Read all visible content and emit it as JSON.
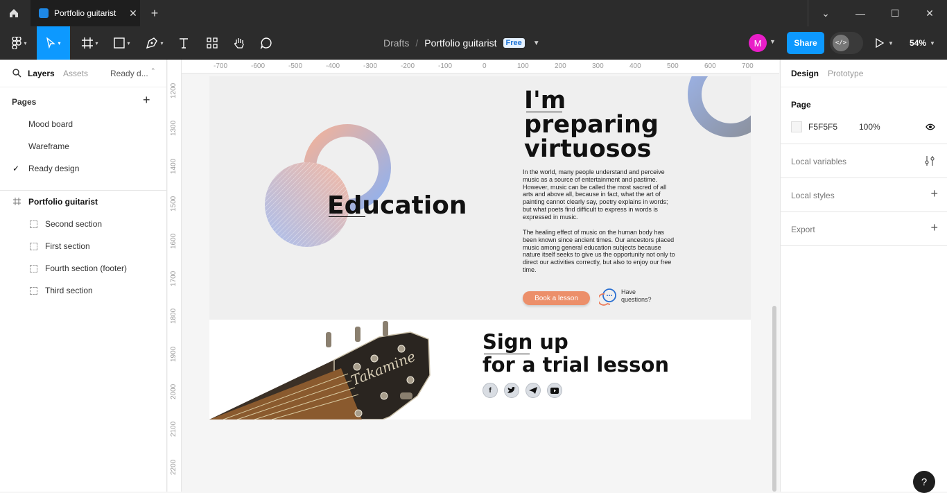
{
  "window": {
    "tab_title": "Portfolio guitarist",
    "tab_close": "✕",
    "new_tab": "+",
    "controls": {
      "chevron": "⌄",
      "minimize": "—",
      "maximize": "☐",
      "close": "✕"
    }
  },
  "toolbar": {
    "breadcrumb": {
      "drafts": "Drafts",
      "slash": "/",
      "file": "Portfolio guitarist",
      "badge": "Free"
    },
    "avatar_letter": "M",
    "share_label": "Share",
    "zoom_label": "54%"
  },
  "left_panel": {
    "tabs": {
      "layers": "Layers",
      "assets": "Assets",
      "page_menu": "Ready d..."
    },
    "pages_heading": "Pages",
    "pages": [
      "Mood board",
      "Wareframe",
      "Ready design"
    ],
    "selected_page_check": "✓",
    "layer_frame": "Portfolio guitarist",
    "layers": [
      "Second section",
      "First section",
      "Fourth section (footer)",
      "Third section"
    ]
  },
  "canvas": {
    "ruler_top": [
      "-700",
      "-600",
      "-500",
      "-400",
      "-300",
      "-200",
      "-100",
      "0",
      "100",
      "200",
      "300",
      "400",
      "500",
      "600",
      "700"
    ],
    "ruler_left": [
      "1200",
      "1300",
      "1400",
      "1500",
      "1600",
      "1700",
      "1800",
      "1900",
      "2000",
      "2100",
      "2200"
    ],
    "design": {
      "education_title": "Education",
      "hero_title_line1": "I'm",
      "hero_title_line2": "preparing",
      "hero_title_line3": "virtuosos",
      "paragraph1": "In the world, many people understand and perceive music as a source of entertainment and pastime. However, music can be called the most sacred of all arts and above all, because in fact, what the art of painting cannot clearly say, poetry explains in words; but what poets find difficult to express in words is expressed in music.",
      "paragraph2": "The healing effect of music on the human body has been known since ancient times. Our ancestors placed music among general education subjects because nature itself seeks to give us the opportunity not only to direct our activities correctly, but also to enjoy our free time.",
      "book_button": "Book a lesson",
      "questions": "Have questions?",
      "signup_line1": "Sign up",
      "signup_line2": "for a trial lesson",
      "guitar_brand": "Takamine",
      "social_icons": [
        "facebook-icon",
        "twitter-icon",
        "telegram-icon",
        "youtube-icon"
      ]
    }
  },
  "right_panel": {
    "tabs": {
      "design": "Design",
      "prototype": "Prototype"
    },
    "page_heading": "Page",
    "page_color": "F5F5F5",
    "page_opacity": "100%",
    "sections": [
      "Local variables",
      "Local styles",
      "Export"
    ]
  },
  "help_label": "?",
  "colors": {
    "accent": "#0d99ff",
    "book_button": "#ec8f6a",
    "avatar": "#e91ec8",
    "page_bg": "#F5F5F5"
  }
}
